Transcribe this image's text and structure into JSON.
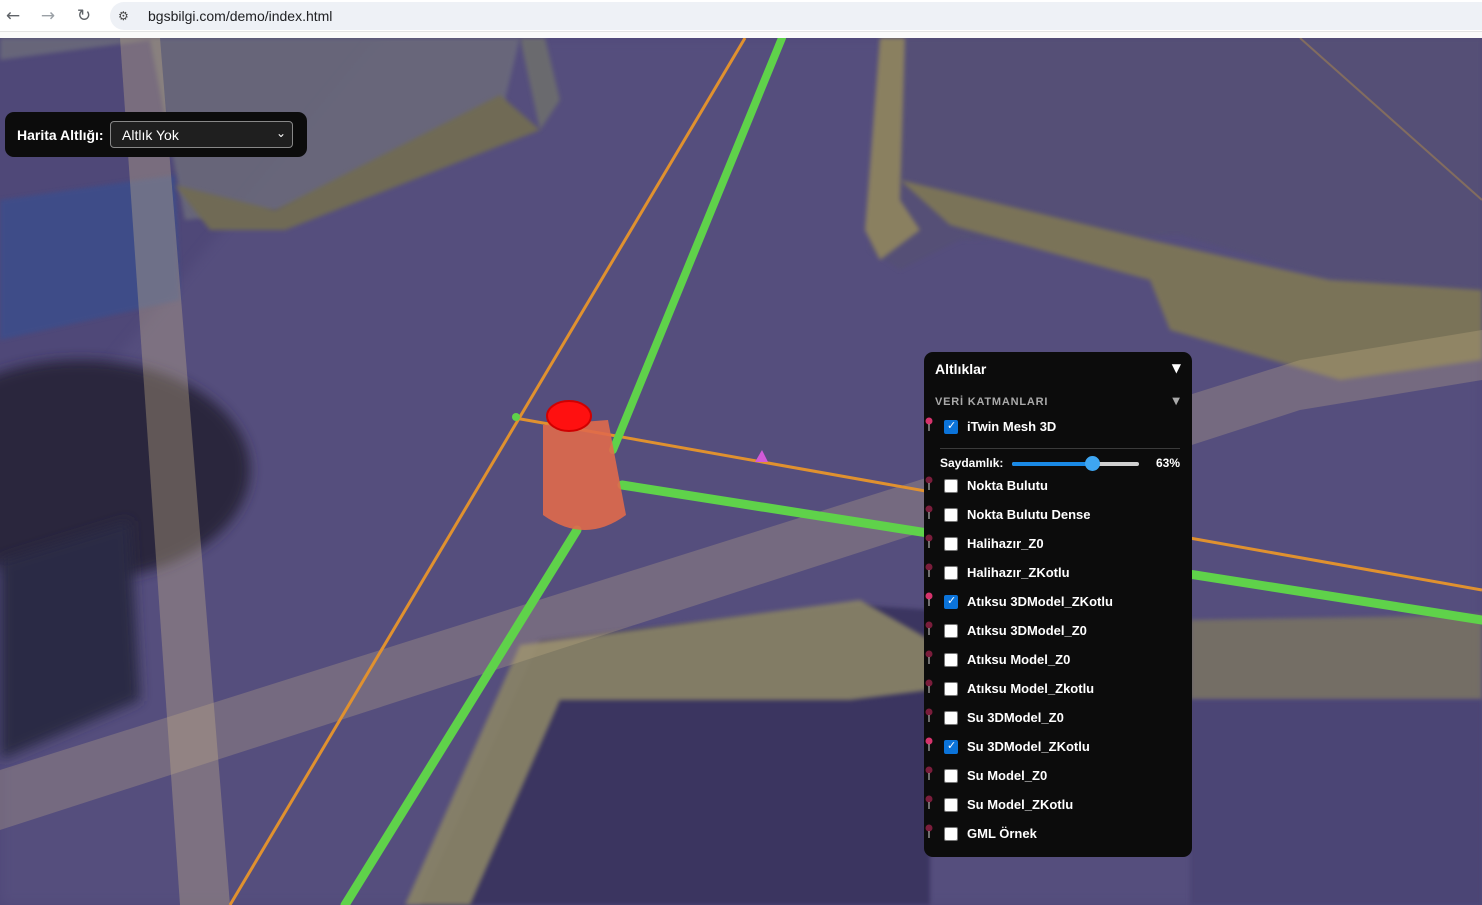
{
  "browser": {
    "url": "bgsbilgi.com/demo/index.html",
    "back_icon": "←",
    "forward_icon": "→",
    "reload_icon": "↻",
    "site_info_icon": "⚙"
  },
  "basemap": {
    "label": "Harita Altlığı:",
    "selected": "Altlık Yok",
    "chevron": "⌄"
  },
  "panel": {
    "title": "Altlıklar",
    "toggle": "▼",
    "section": {
      "title": "VERİ KATMANLARI",
      "toggle": "▼"
    },
    "opacity": {
      "label": "Saydamlık:",
      "value": 63,
      "value_text": "63%"
    },
    "layers": [
      {
        "label": "iTwin Mesh 3D",
        "checked": true
      },
      {
        "label": "Nokta Bulutu",
        "checked": false
      },
      {
        "label": "Nokta Bulutu Dense",
        "checked": false
      },
      {
        "label": "Halihazır_Z0",
        "checked": false
      },
      {
        "label": "Halihazır_ZKotlu",
        "checked": false
      },
      {
        "label": "Atıksu 3DModel_ZKotlu",
        "checked": true
      },
      {
        "label": "Atıksu 3DModel_Z0",
        "checked": false
      },
      {
        "label": "Atıksu Model_Z0",
        "checked": false
      },
      {
        "label": "Atıksu Model_Zkotlu",
        "checked": false
      },
      {
        "label": "Su 3DModel_Z0",
        "checked": false
      },
      {
        "label": "Su 3DModel_ZKotlu",
        "checked": true
      },
      {
        "label": "Su Model_Z0",
        "checked": false
      },
      {
        "label": "Su Model_ZKotlu",
        "checked": false
      },
      {
        "label": "GML Örnek",
        "checked": false
      }
    ],
    "checkmark": "✓"
  },
  "colors": {
    "checkbox_checked": "#0b73d9",
    "pin_active": "#d6336c",
    "pin_inactive": "#7a1d3b",
    "pipe_green": "#5fd24a",
    "pipe_orange": "#e0912f",
    "manhole_red": "#ff1010"
  }
}
